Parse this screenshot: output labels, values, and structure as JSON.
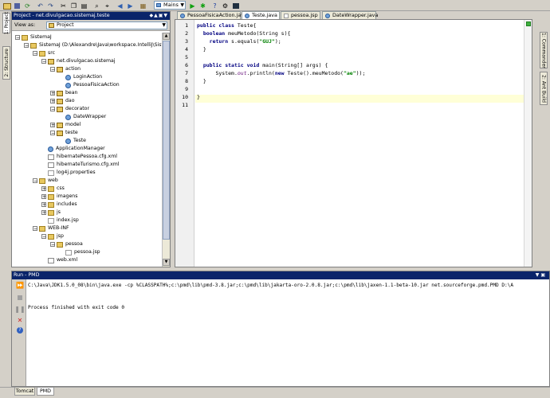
{
  "toolbar": {
    "config_label": "Mains",
    "config_icon": "run-config-icon"
  },
  "left_panel": {
    "title": "Project - net.divulgacao.sistemaj.teste",
    "view_as_label": "View as:",
    "view_as_value": "Project",
    "vtabs": [
      "1: Project",
      "2: Structure"
    ]
  },
  "tree": [
    {
      "label": "SistemaJ",
      "icon": "module",
      "indent": 0,
      "exp": "-"
    },
    {
      "label": "SistemaJ (D:\\Alexandre\\Java\\workspace.IntelliJ\\SistemaJ)",
      "icon": "module",
      "indent": 1,
      "exp": "-"
    },
    {
      "label": "src",
      "icon": "folder",
      "indent": 2,
      "exp": "-"
    },
    {
      "label": "net.divulgacao.sistemaj",
      "icon": "pkg",
      "indent": 3,
      "exp": "-"
    },
    {
      "label": "action",
      "icon": "pkg",
      "indent": 4,
      "exp": "-"
    },
    {
      "label": "LoginAction",
      "icon": "cls",
      "indent": 5,
      "exp": ""
    },
    {
      "label": "PessoaFisicaAction",
      "icon": "cls",
      "indent": 5,
      "exp": ""
    },
    {
      "label": "bean",
      "icon": "pkg",
      "indent": 4,
      "exp": "+"
    },
    {
      "label": "dao",
      "icon": "pkg",
      "indent": 4,
      "exp": "+"
    },
    {
      "label": "decorator",
      "icon": "pkg",
      "indent": 4,
      "exp": "-"
    },
    {
      "label": "DateWrapper",
      "icon": "cls",
      "indent": 5,
      "exp": ""
    },
    {
      "label": "model",
      "icon": "pkg",
      "indent": 4,
      "exp": "+"
    },
    {
      "label": "teste",
      "icon": "pkg",
      "indent": 4,
      "exp": "-"
    },
    {
      "label": "Teste",
      "icon": "cls",
      "indent": 5,
      "exp": ""
    },
    {
      "label": "ApplicationManager",
      "icon": "cls",
      "indent": 3,
      "exp": ""
    },
    {
      "label": "hibernatePessoa.cfg.xml",
      "icon": "xml",
      "indent": 3,
      "exp": ""
    },
    {
      "label": "hibernateTurismo.cfg.xml",
      "icon": "xml",
      "indent": 3,
      "exp": ""
    },
    {
      "label": "log4j.properties",
      "icon": "file",
      "indent": 3,
      "exp": ""
    },
    {
      "label": "web",
      "icon": "folder",
      "indent": 2,
      "exp": "-"
    },
    {
      "label": "css",
      "icon": "folder",
      "indent": 3,
      "exp": "+"
    },
    {
      "label": "imagens",
      "icon": "folder",
      "indent": 3,
      "exp": "+"
    },
    {
      "label": "includes",
      "icon": "folder",
      "indent": 3,
      "exp": "+"
    },
    {
      "label": "js",
      "icon": "folder",
      "indent": 3,
      "exp": "+"
    },
    {
      "label": "index.jsp",
      "icon": "file",
      "indent": 3,
      "exp": ""
    },
    {
      "label": "WEB-INF",
      "icon": "folder",
      "indent": 2,
      "exp": "-"
    },
    {
      "label": "jsp",
      "icon": "folder",
      "indent": 3,
      "exp": "-"
    },
    {
      "label": "pessoa",
      "icon": "folder",
      "indent": 4,
      "exp": "-"
    },
    {
      "label": "pessoa.jsp",
      "icon": "file",
      "indent": 5,
      "exp": ""
    },
    {
      "label": "web.xml",
      "icon": "xml",
      "indent": 3,
      "exp": ""
    }
  ],
  "editor": {
    "tabs": [
      {
        "label": "PessoaFisicaAction.java",
        "active": false
      },
      {
        "label": "Teste.java",
        "active": true
      },
      {
        "label": "pessoa.jsp",
        "active": false
      },
      {
        "label": "DateWrapper.java",
        "active": false
      }
    ],
    "line_numbers": [
      "1",
      "2",
      "3",
      "4",
      "5",
      "6",
      "7",
      "8",
      "9",
      "10",
      "11"
    ],
    "right_vtabs": [
      "1: Commander",
      "2: Ant Build"
    ]
  },
  "run_panel": {
    "title": "Run - PMD",
    "command": "C:\\Java\\JDK1.5.0_08\\bin\\java.exe -cp %CLASSPATH%;c:\\pmd\\lib\\pmd-3.8.jar;c:\\pmd\\lib\\jakarta-oro-2.0.8.jar;c:\\pmd\\lib\\jaxen-1.1-beta-10.jar net.sourceforge.pmd.PMD D:\\A",
    "exit_message": "Process finished with exit code 0"
  },
  "bottom_tabs": [
    "Tomcat",
    "PMD"
  ],
  "colors": {
    "title_active": "#0a246a",
    "caret_line": "#ffffd7",
    "editor_bg": "#ffffff",
    "panel_bg": "#d4d0c8"
  }
}
